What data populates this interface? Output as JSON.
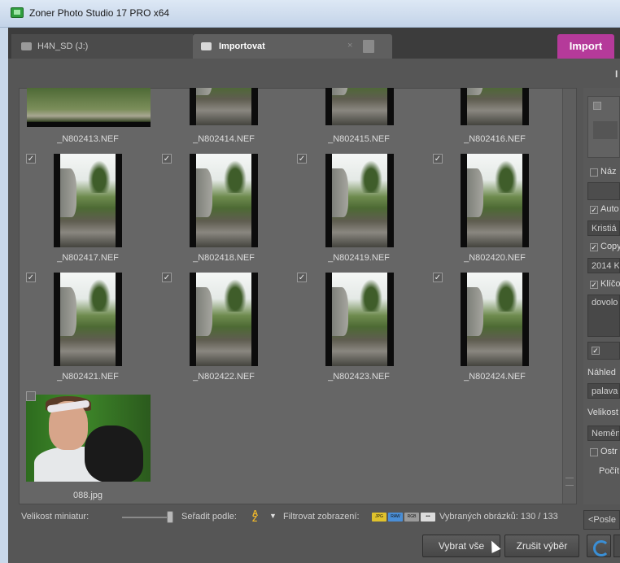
{
  "window": {
    "title": "Zoner Photo Studio 17 PRO x64"
  },
  "tabs": [
    {
      "label": "H4N_SD (J:)"
    },
    {
      "label": "Importovat"
    }
  ],
  "import_button": "Import",
  "subheader_letter": "I",
  "thumbnails": [
    {
      "name": "_N802413.NEF",
      "checked": null
    },
    {
      "name": "_N802414.NEF",
      "checked": null
    },
    {
      "name": "_N802415.NEF",
      "checked": null
    },
    {
      "name": "_N802416.NEF",
      "checked": null
    },
    {
      "name": "_N802417.NEF",
      "checked": true
    },
    {
      "name": "_N802418.NEF",
      "checked": true
    },
    {
      "name": "_N802419.NEF",
      "checked": true
    },
    {
      "name": "_N802420.NEF",
      "checked": true
    },
    {
      "name": "_N802421.NEF",
      "checked": true
    },
    {
      "name": "_N802422.NEF",
      "checked": true
    },
    {
      "name": "_N802423.NEF",
      "checked": true
    },
    {
      "name": "_N802424.NEF",
      "checked": true
    },
    {
      "name": "088.jpg",
      "checked": false
    }
  ],
  "checkmark": "✓",
  "bottombar": {
    "thumb_size_label": "Velikost miniatur:",
    "sort_label": "Seřadit podle:",
    "filter_label": "Filtrovat zobrazení:",
    "selected_count": "Vybraných obrázků: 130 / 133"
  },
  "buttons": {
    "select_all": "Vybrat vše",
    "deselect": "Zrušit výběr"
  },
  "right_panel": {
    "name_label": "Náz",
    "author_label": "Auto",
    "author_value": "Kristiá",
    "copyright_label": "Copy",
    "copyright_value": "2014 K",
    "keywords_label": "Klíčo",
    "keywords_value": "dovolo",
    "preview_label": "Náhled",
    "preview_value": "palava",
    "size_label": "Velikost",
    "size_value": "Neměn",
    "sharpen_label": "Ostr",
    "count_label": "Počít",
    "bottom_field": "<Posle"
  },
  "colors": {
    "accent_import": "#b53a9a",
    "panel_bg": "#565656",
    "grid_bg": "#666666"
  }
}
